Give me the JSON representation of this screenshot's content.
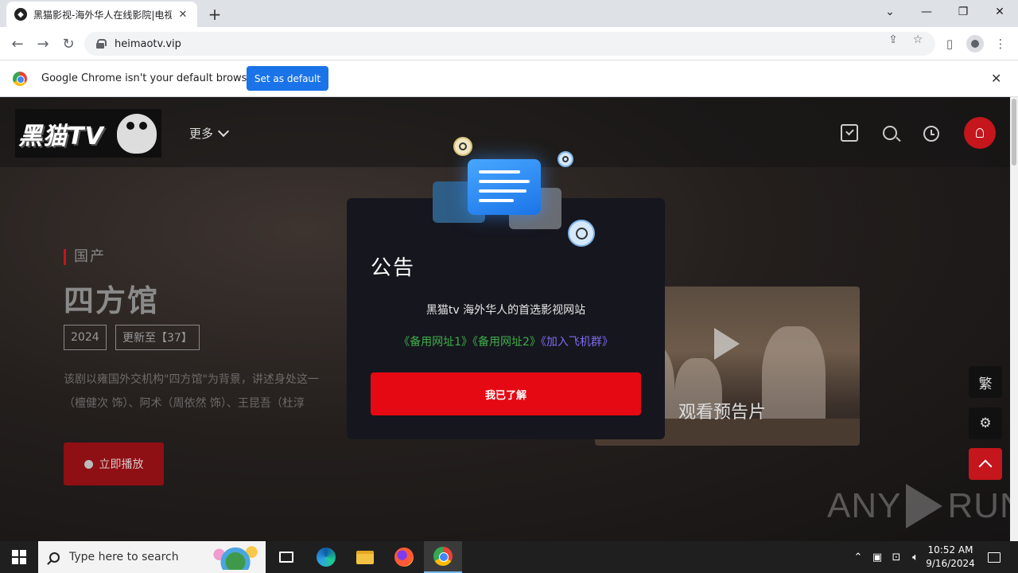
{
  "browser": {
    "tab_title": "黑猫影视-海外华人在线影院|电视",
    "tab_close": "✕",
    "new_tab": "+",
    "url": "heimaotv.vip",
    "window_controls": {
      "tabsearch": "⌄",
      "minimize": "—",
      "restore": "❐",
      "close": "✕"
    },
    "infobar": {
      "message": "Google Chrome isn't your default browser",
      "button": "Set as default",
      "close": "✕"
    }
  },
  "site": {
    "logo_text": "黑猫TV",
    "nav_more": "更多",
    "hero": {
      "tag": "国产",
      "title": "四方馆",
      "year": "2024",
      "episodes": "更新至【37】",
      "description_line1": "该剧以雍国外交机构\"四方馆\"为背景，讲述身处这一",
      "description_line2": "（檀健次 饰）、阿术（周依然 饰）、王昆吾（杜淳",
      "play_label": "立即播放"
    },
    "trailer_label": "观看预告片",
    "side_buttons": {
      "traditional": "繁",
      "settings": "⚙"
    },
    "watermark": {
      "left": "ANY",
      "right": "RUN"
    }
  },
  "modal": {
    "title": "公告",
    "subtitle": "黑猫tv 海外华人的首选影视网站",
    "link1": "《备用网址1》",
    "link2": "《备用网址2》",
    "link3": "《加入飞机群》",
    "button": "我已了解"
  },
  "taskbar": {
    "search_placeholder": "Type here to search",
    "time": "10:52 AM",
    "date": "9/16/2024"
  }
}
